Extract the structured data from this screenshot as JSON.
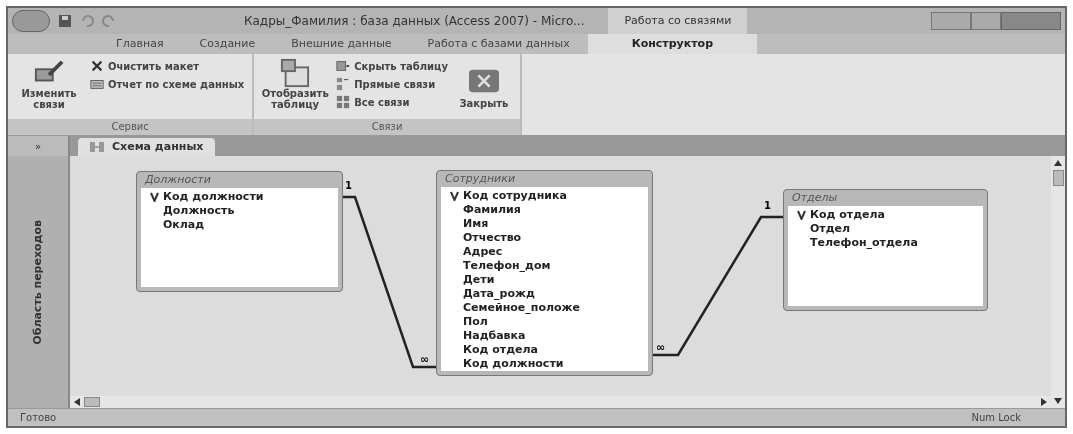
{
  "window": {
    "title": "Кадры_Фамилия : база данных (Access 2007) - Micro...",
    "context_tab": "Работа со связями"
  },
  "tabs": [
    {
      "label": "Главная",
      "selected": false
    },
    {
      "label": "Создание",
      "selected": false
    },
    {
      "label": "Внешние данные",
      "selected": false
    },
    {
      "label": "Работа с базами данных",
      "selected": false
    },
    {
      "label": "Конструктор",
      "selected": true
    }
  ],
  "ribbon": {
    "groups": [
      {
        "label": "Сервис",
        "large": [
          {
            "label": "Изменить связи"
          }
        ],
        "small": [
          {
            "label": "Очистить макет"
          },
          {
            "label": "Отчет по схеме данных"
          }
        ]
      },
      {
        "label": "Связи",
        "large": [
          {
            "label": "Отобразить таблицу"
          }
        ],
        "small": [
          {
            "label": "Скрыть таблицу"
          },
          {
            "label": "Прямые связи"
          },
          {
            "label": "Все связи"
          }
        ],
        "after": [
          {
            "label": "Закрыть"
          }
        ]
      }
    ]
  },
  "nav_pane": {
    "toggle": "»",
    "label": "Область переходов"
  },
  "document_tab": {
    "label": "Схема данных"
  },
  "tables": [
    {
      "name": "Должности",
      "fields": [
        {
          "name": "Код должности",
          "key": true
        },
        {
          "name": "Должность",
          "key": false
        },
        {
          "name": "Оклад",
          "key": false
        }
      ]
    },
    {
      "name": "Сотрудники",
      "fields": [
        {
          "name": "Код сотрудника",
          "key": true
        },
        {
          "name": "Фамилия",
          "key": false
        },
        {
          "name": "Имя",
          "key": false
        },
        {
          "name": "Отчество",
          "key": false
        },
        {
          "name": "Адрес",
          "key": false
        },
        {
          "name": "Телефон_дом",
          "key": false
        },
        {
          "name": "Дети",
          "key": false
        },
        {
          "name": "Дата_рожд",
          "key": false
        },
        {
          "name": "Семейное_положе",
          "key": false
        },
        {
          "name": "Пол",
          "key": false
        },
        {
          "name": "Надбавка",
          "key": false
        },
        {
          "name": "Код отдела",
          "key": false
        },
        {
          "name": "Код должности",
          "key": false
        }
      ]
    },
    {
      "name": "Отделы",
      "fields": [
        {
          "name": "Код отдела",
          "key": true
        },
        {
          "name": "Отдел",
          "key": false
        },
        {
          "name": "Телефон_отдела",
          "key": false
        }
      ]
    }
  ],
  "relationships": [
    {
      "one_label": "1",
      "many_label": "∞"
    },
    {
      "one_label": "1",
      "many_label": "∞"
    }
  ],
  "status_bar": {
    "left": "Готово",
    "right": "Num Lock"
  }
}
